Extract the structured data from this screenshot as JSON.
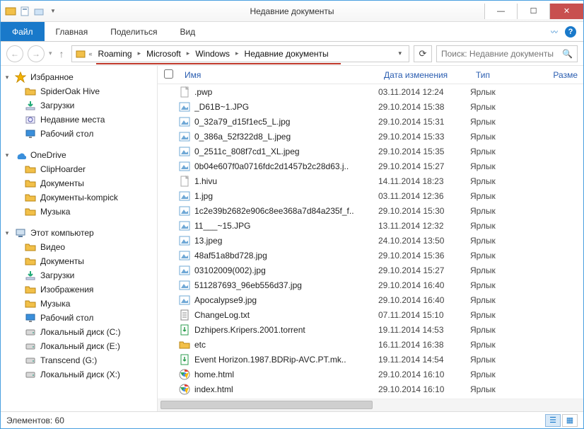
{
  "window": {
    "title": "Недавние документы"
  },
  "ribbon": {
    "file": "Файл",
    "tabs": [
      "Главная",
      "Поделиться",
      "Вид"
    ]
  },
  "address": {
    "prefix": "«",
    "segments": [
      "Roaming",
      "Microsoft",
      "Windows",
      "Недавние документы"
    ]
  },
  "search": {
    "placeholder": "Поиск: Недавние документы"
  },
  "columns": {
    "name": "Имя",
    "date": "Дата изменения",
    "type": "Тип",
    "size": "Разме"
  },
  "sidebar": {
    "favorites": {
      "label": "Избранное",
      "items": [
        "SpiderOak Hive",
        "Загрузки",
        "Недавние места",
        "Рабочий стол"
      ]
    },
    "onedrive": {
      "label": "OneDrive",
      "items": [
        "ClipHoarder",
        "Документы",
        "Документы-kompick",
        "Музыка"
      ]
    },
    "thispc": {
      "label": "Этот компьютер",
      "items": [
        "Видео",
        "Документы",
        "Загрузки",
        "Изображения",
        "Музыка",
        "Рабочий стол",
        "Локальный диск (C:)",
        "Локальный диск (E:)",
        "Transcend (G:)",
        "Локальный диск (X:)"
      ]
    }
  },
  "files": [
    {
      "icon": "file",
      "name": ".pwp",
      "date": "03.11.2014 12:24",
      "type": "Ярлык"
    },
    {
      "icon": "image",
      "name": "_D61B~1.JPG",
      "date": "29.10.2014 15:38",
      "type": "Ярлык"
    },
    {
      "icon": "image",
      "name": "0_32a79_d15f1ec5_L.jpg",
      "date": "29.10.2014 15:31",
      "type": "Ярлык"
    },
    {
      "icon": "image",
      "name": "0_386a_52f322d8_L.jpeg",
      "date": "29.10.2014 15:33",
      "type": "Ярлык"
    },
    {
      "icon": "image",
      "name": "0_2511c_808f7cd1_XL.jpeg",
      "date": "29.10.2014 15:35",
      "type": "Ярлык"
    },
    {
      "icon": "image",
      "name": "0b04e607f0a0716fdc2d1457b2c28d63.j..",
      "date": "29.10.2014 15:27",
      "type": "Ярлык"
    },
    {
      "icon": "file",
      "name": "1.hivu",
      "date": "14.11.2014 18:23",
      "type": "Ярлык"
    },
    {
      "icon": "image",
      "name": "1.jpg",
      "date": "03.11.2014 12:36",
      "type": "Ярлык"
    },
    {
      "icon": "image",
      "name": "1c2e39b2682e906c8ee368a7d84a235f_f..",
      "date": "29.10.2014 15:30",
      "type": "Ярлык"
    },
    {
      "icon": "image",
      "name": "11___~15.JPG",
      "date": "13.11.2014 12:32",
      "type": "Ярлык"
    },
    {
      "icon": "image",
      "name": "13.jpeg",
      "date": "24.10.2014 13:50",
      "type": "Ярлык"
    },
    {
      "icon": "image",
      "name": "48af51a8bd728.jpg",
      "date": "29.10.2014 15:36",
      "type": "Ярлык"
    },
    {
      "icon": "image",
      "name": "03102009(002).jpg",
      "date": "29.10.2014 15:27",
      "type": "Ярлык"
    },
    {
      "icon": "image",
      "name": "511287693_96eb556d37.jpg",
      "date": "29.10.2014 16:40",
      "type": "Ярлык"
    },
    {
      "icon": "image",
      "name": "Apocalypse9.jpg",
      "date": "29.10.2014 16:40",
      "type": "Ярлык"
    },
    {
      "icon": "text",
      "name": "ChangeLog.txt",
      "date": "07.11.2014 15:10",
      "type": "Ярлык"
    },
    {
      "icon": "torrent",
      "name": "Dzhipers.Kripers.2001.torrent",
      "date": "19.11.2014 14:53",
      "type": "Ярлык"
    },
    {
      "icon": "folder",
      "name": "etc",
      "date": "16.11.2014 16:38",
      "type": "Ярлык"
    },
    {
      "icon": "torrent",
      "name": "Event Horizon.1987.BDRip-AVC.PT.mk..",
      "date": "19.11.2014 14:54",
      "type": "Ярлык"
    },
    {
      "icon": "chrome",
      "name": "home.html",
      "date": "29.10.2014 16:10",
      "type": "Ярлык"
    },
    {
      "icon": "chrome",
      "name": "index.html",
      "date": "29.10.2014 16:10",
      "type": "Ярлык"
    }
  ],
  "status": {
    "elements_label": "Элементов:",
    "elements_count": "60"
  }
}
